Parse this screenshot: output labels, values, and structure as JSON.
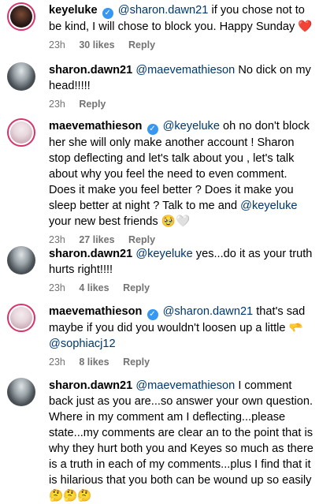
{
  "comments": [
    {
      "username": "keyeluke",
      "verified": true,
      "mention": "@sharon.dawn21",
      "text": " if you chose not to be kind, I will chose to block you. Happy Sunday ",
      "emoji": "❤️",
      "time": "23h",
      "likes": "30 likes",
      "reply": "Reply"
    },
    {
      "username": "sharon.dawn21",
      "mention": "@maevemathieson",
      "text": " No dick on my head!!!!!",
      "time": "23h",
      "reply": "Reply"
    },
    {
      "username": "maevemathieson",
      "verified": true,
      "mention": "@keyeluke",
      "text": " oh no don't block her she will only make another account ! Sharon stop deflecting and let's talk about you , let's talk about why you feel the need to even comment. Does it make you feel better ? Does it make you sleep better at night ? Talk to me and ",
      "mention2": "@keyeluke",
      "text2": " your new best friends ",
      "emoji": "🥹🤍",
      "time": "23h",
      "likes": "27 likes",
      "reply": "Reply"
    },
    {
      "username": "sharon.dawn21",
      "mention": "@keyeluke",
      "text": " yes...do it as your truth hurts right!!!!",
      "time": "23h",
      "likes": "4 likes",
      "reply": "Reply"
    },
    {
      "username": "maevemathieson",
      "verified": true,
      "mention": "@sharon.dawn21",
      "text": " that's sad maybe if you did you wouldn't loosen up a little ",
      "emoji": "🫳",
      "mention2": "@sophiacj12",
      "time": "23h",
      "likes": "8 likes",
      "reply": "Reply"
    },
    {
      "username": "sharon.dawn21",
      "mention": "@maevemathieson",
      "text": " I comment back just as you are...so answer your own question. Where in my comment am I deflecting...please state...my comments are clear an to the point that is why they hurt both you and Keyes so much as there is a truth in each of my comments...plus I find that it is hilarious that you both can be wound up so easily ",
      "emoji": "🤔🤔🤔"
    }
  ]
}
